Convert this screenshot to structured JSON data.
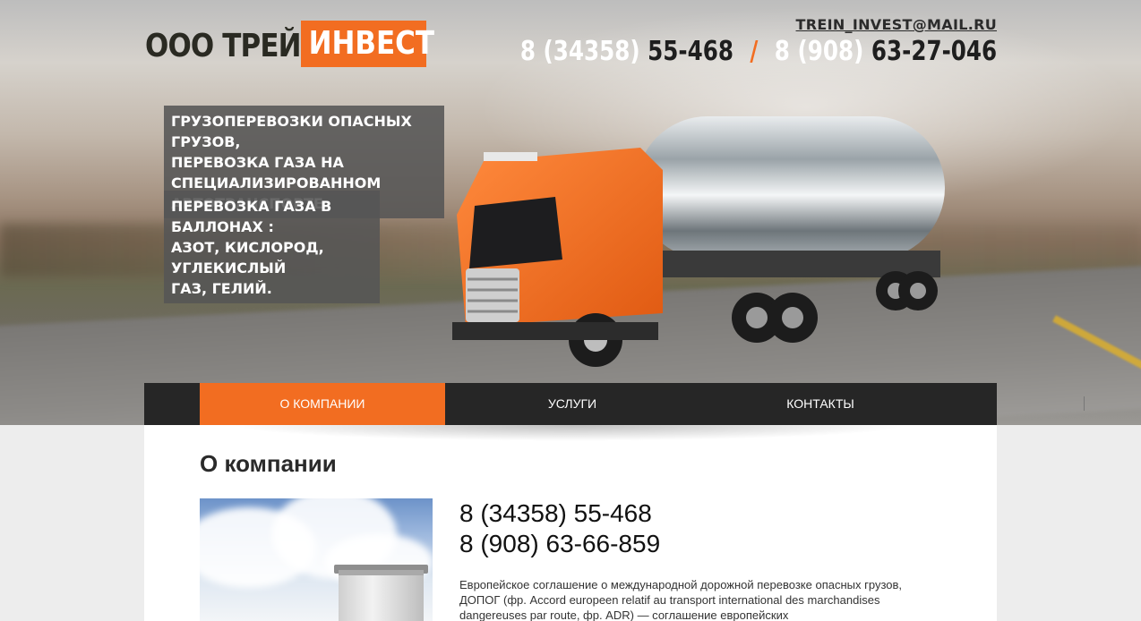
{
  "header": {
    "logo_dark": "ООО ТРЕЙН",
    "logo_accent": "ИНВЕСТ",
    "email": "TREIN_INVEST@MAIL.RU",
    "phone1_code": "8 (34358)",
    "phone1_num": "55-468",
    "separator": "/",
    "phone2_code": "8 (908)",
    "phone2_num": "63-27-046"
  },
  "promo": {
    "block1_lines": [
      "ГРУЗОПЕРЕВОЗКИ ОПАСНЫХ ГРУЗОВ,",
      "ПЕРЕВОЗКА ГАЗА НА",
      "СПЕЦИАЛИЗИРОВАННОМ АВТОТРАНСПОРТЕ."
    ],
    "block2_lines": [
      "ПЕРЕВОЗКА ГАЗА В БАЛЛОНАХ :",
      "АЗОТ, КИСЛОРОД, УГЛЕКИСЛЫЙ",
      "ГАЗ, ГЕЛИЙ."
    ]
  },
  "nav": {
    "items": [
      {
        "label": "О КОМПАНИИ",
        "active": true
      },
      {
        "label": "УСЛУГИ",
        "active": false
      },
      {
        "label": "КОНТАКТЫ",
        "active": false
      }
    ]
  },
  "content": {
    "title": "О компании",
    "phone1": "8 (34358) 55-468",
    "phone2": "8 (908) 63-66-859",
    "text": "Европейское соглашение о международной дорожной перевозке опасных грузов, ДОПОГ (фр. Accord europeen relatif au transport international des marchandises dangereuses par route, фр. ADR) — соглашение европейских"
  },
  "colors": {
    "accent": "#f26d21",
    "nav_bg": "#262626",
    "promo_bg": "#555555"
  }
}
